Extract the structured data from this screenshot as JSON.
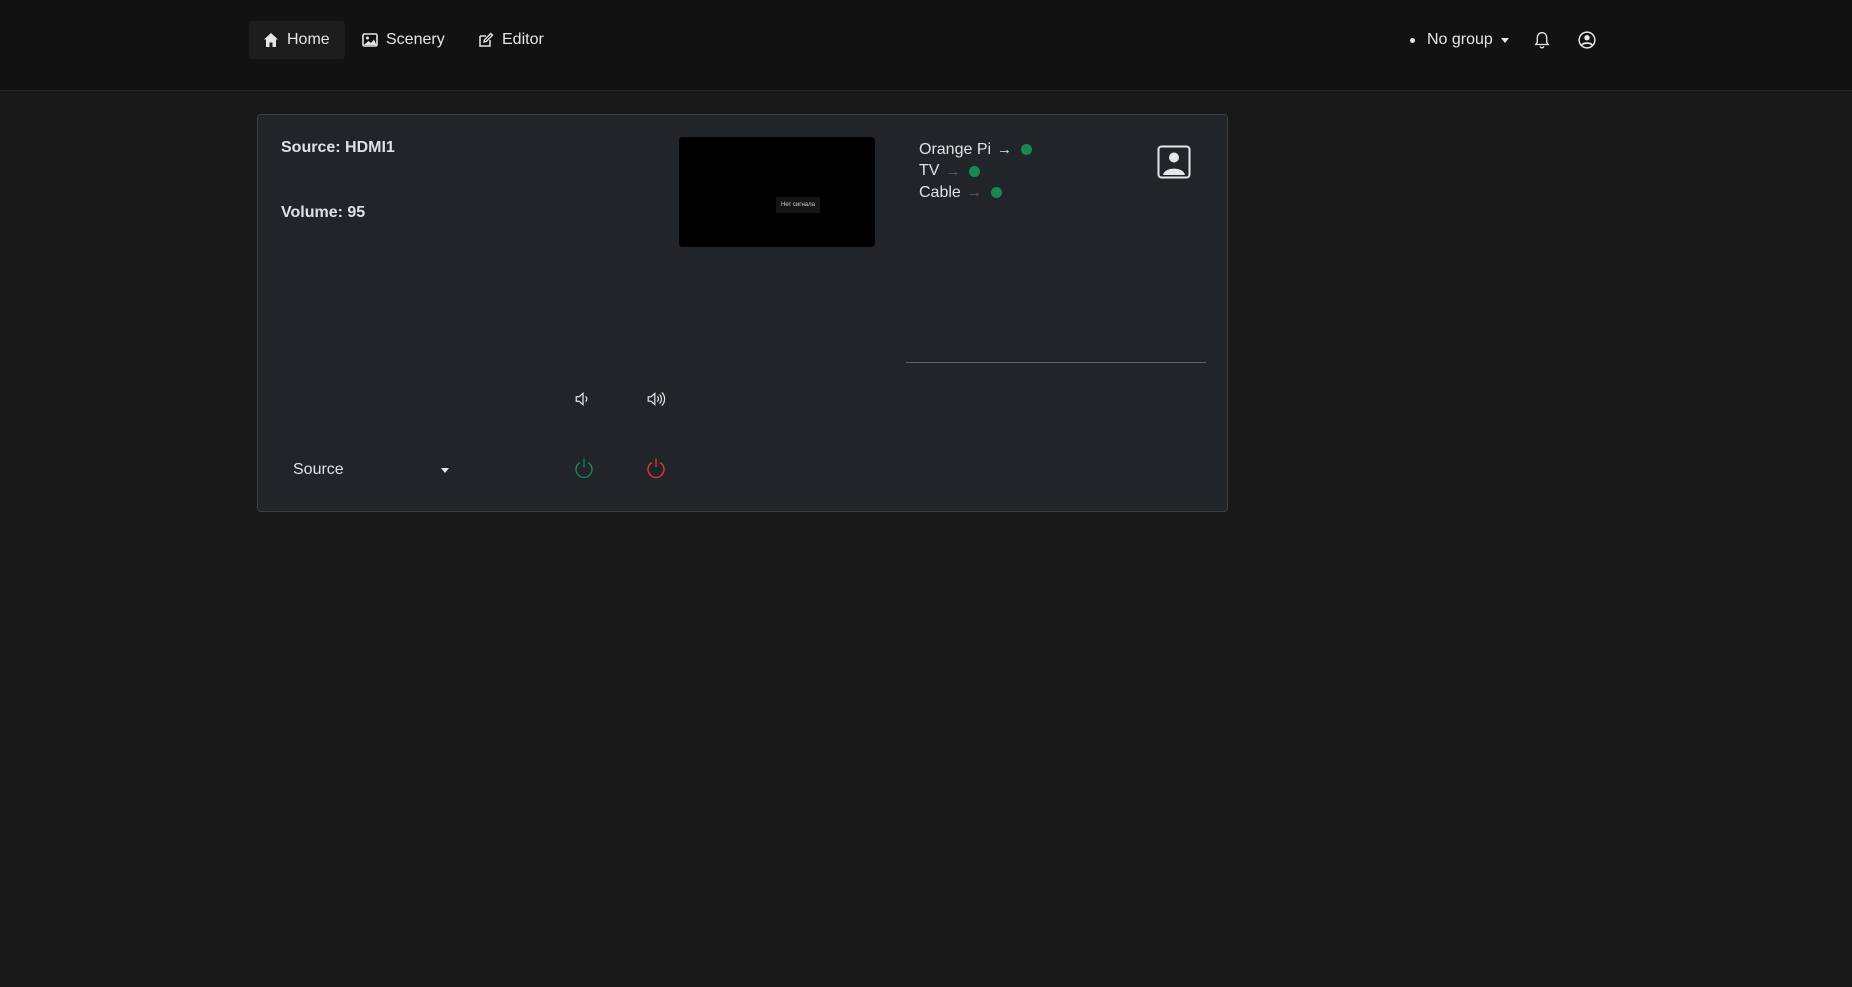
{
  "nav": {
    "items": [
      {
        "label": "Home",
        "icon": "house-icon"
      },
      {
        "label": "Scenery",
        "icon": "image-icon"
      },
      {
        "label": "Editor",
        "icon": "pencil-square-icon"
      }
    ],
    "group_label": "No group",
    "bell_icon": "bell-icon",
    "user_icon": "person-circle-icon"
  },
  "panel": {
    "source_text": "Source: HDMI1",
    "volume_text": "Volume: 95",
    "preview_text": "Нет сигнала",
    "devices": [
      {
        "name": "Orange Pi",
        "arrow": "→",
        "status_color": "#198754"
      },
      {
        "name": "TV",
        "arrow": "→",
        "status_color": "#198754"
      },
      {
        "name": "Cable",
        "arrow": "→",
        "status_color": "#198754"
      }
    ],
    "source_select_label": "Source",
    "colors": {
      "power_on": "#198754",
      "power_off": "#dc3545",
      "status": "#198754"
    }
  }
}
